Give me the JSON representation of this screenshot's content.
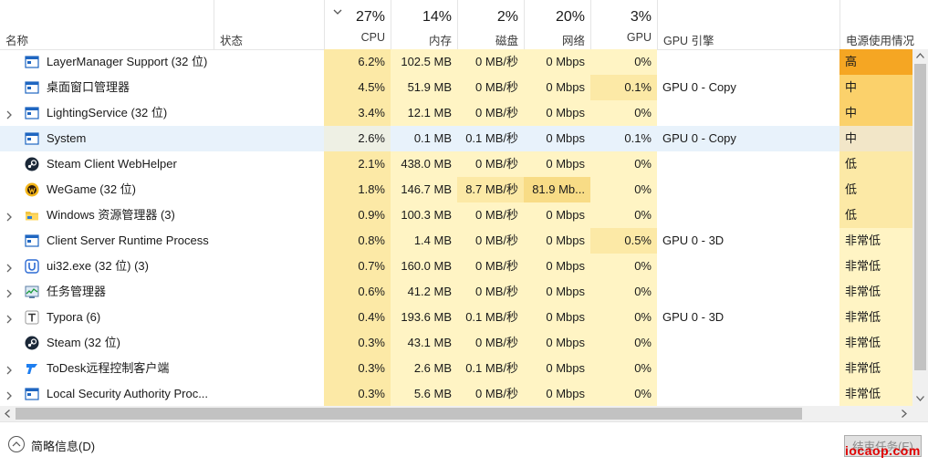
{
  "header": {
    "name_label": "名称",
    "status_label": "状态",
    "cpu": {
      "pct": "27%",
      "label": "CPU"
    },
    "memory": {
      "pct": "14%",
      "label": "内存"
    },
    "disk": {
      "pct": "2%",
      "label": "磁盘"
    },
    "network": {
      "pct": "20%",
      "label": "网络"
    },
    "gpu": {
      "pct": "3%",
      "label": "GPU"
    },
    "gpu_engine_label": "GPU 引擎",
    "power_label": "电源使用情况"
  },
  "colors": {
    "heat_light": "#fff4c4",
    "heat_mid": "#fce9a6",
    "heat_strong": "#f8dc86",
    "power_very_high": "#f5a623",
    "power_high": "#fbd16b",
    "power_low": "#fce9a6",
    "power_very_low": "#fff4c4",
    "selected_row": "#e8f2fb"
  },
  "rows": [
    {
      "name": "LayerManager Support (32 位)",
      "icon": "window-app-icon",
      "expandable": false,
      "cpu": "6.2%",
      "memory": "102.5 MB",
      "disk": "0 MB/秒",
      "network": "0 Mbps",
      "gpu": "0%",
      "gpu_engine": "",
      "power": "高",
      "power_level": "very_high",
      "selected": false,
      "gpu_hl": false,
      "disk_hl": false,
      "net_hl": false
    },
    {
      "name": "桌面窗口管理器",
      "icon": "window-app-icon",
      "expandable": false,
      "cpu": "4.5%",
      "memory": "51.9 MB",
      "disk": "0 MB/秒",
      "network": "0 Mbps",
      "gpu": "0.1%",
      "gpu_engine": "GPU 0 - Copy",
      "power": "中",
      "power_level": "high",
      "selected": false,
      "gpu_hl": true,
      "disk_hl": false,
      "net_hl": false
    },
    {
      "name": "LightingService (32 位)",
      "icon": "window-app-icon",
      "expandable": true,
      "cpu": "3.4%",
      "memory": "12.1 MB",
      "disk": "0 MB/秒",
      "network": "0 Mbps",
      "gpu": "0%",
      "gpu_engine": "",
      "power": "中",
      "power_level": "high",
      "selected": false,
      "gpu_hl": false,
      "disk_hl": false,
      "net_hl": false
    },
    {
      "name": "System",
      "icon": "window-app-icon",
      "expandable": false,
      "cpu": "2.6%",
      "memory": "0.1 MB",
      "disk": "0.1 MB/秒",
      "network": "0 Mbps",
      "gpu": "0.1%",
      "gpu_engine": "GPU 0 - Copy",
      "power": "中",
      "power_level": "high",
      "selected": true,
      "gpu_hl": true,
      "disk_hl": true,
      "net_hl": false
    },
    {
      "name": "Steam Client WebHelper",
      "icon": "steam-icon",
      "expandable": false,
      "cpu": "2.1%",
      "memory": "438.0 MB",
      "disk": "0 MB/秒",
      "network": "0 Mbps",
      "gpu": "0%",
      "gpu_engine": "",
      "power": "低",
      "power_level": "low",
      "selected": false,
      "gpu_hl": false,
      "disk_hl": false,
      "net_hl": false
    },
    {
      "name": "WeGame (32 位)",
      "icon": "wegame-icon",
      "expandable": false,
      "cpu": "1.8%",
      "memory": "146.7 MB",
      "disk": "8.7 MB/秒",
      "network": "81.9 Mb...",
      "gpu": "0%",
      "gpu_engine": "",
      "power": "低",
      "power_level": "low",
      "selected": false,
      "gpu_hl": false,
      "disk_hl": true,
      "net_hl": true
    },
    {
      "name": "Windows 资源管理器 (3)",
      "icon": "folder-icon",
      "expandable": true,
      "cpu": "0.9%",
      "memory": "100.3 MB",
      "disk": "0 MB/秒",
      "network": "0 Mbps",
      "gpu": "0%",
      "gpu_engine": "",
      "power": "低",
      "power_level": "low",
      "selected": false,
      "gpu_hl": false,
      "disk_hl": false,
      "net_hl": false
    },
    {
      "name": "Client Server Runtime Process",
      "icon": "window-app-icon",
      "expandable": false,
      "cpu": "0.8%",
      "memory": "1.4 MB",
      "disk": "0 MB/秒",
      "network": "0 Mbps",
      "gpu": "0.5%",
      "gpu_engine": "GPU 0 - 3D",
      "power": "非常低",
      "power_level": "very_low",
      "selected": false,
      "gpu_hl": true,
      "disk_hl": false,
      "net_hl": false
    },
    {
      "name": "ui32.exe (32 位) (3)",
      "icon": "ui32-icon",
      "expandable": true,
      "cpu": "0.7%",
      "memory": "160.0 MB",
      "disk": "0 MB/秒",
      "network": "0 Mbps",
      "gpu": "0%",
      "gpu_engine": "",
      "power": "非常低",
      "power_level": "very_low",
      "selected": false,
      "gpu_hl": false,
      "disk_hl": false,
      "net_hl": false
    },
    {
      "name": "任务管理器",
      "icon": "task-manager-icon",
      "expandable": true,
      "cpu": "0.6%",
      "memory": "41.2 MB",
      "disk": "0 MB/秒",
      "network": "0 Mbps",
      "gpu": "0%",
      "gpu_engine": "",
      "power": "非常低",
      "power_level": "very_low",
      "selected": false,
      "gpu_hl": false,
      "disk_hl": false,
      "net_hl": false
    },
    {
      "name": "Typora (6)",
      "icon": "typora-icon",
      "expandable": true,
      "cpu": "0.4%",
      "memory": "193.6 MB",
      "disk": "0.1 MB/秒",
      "network": "0 Mbps",
      "gpu": "0%",
      "gpu_engine": "GPU 0 - 3D",
      "power": "非常低",
      "power_level": "very_low",
      "selected": false,
      "gpu_hl": false,
      "disk_hl": false,
      "net_hl": false
    },
    {
      "name": "Steam (32 位)",
      "icon": "steam-icon",
      "expandable": false,
      "cpu": "0.3%",
      "memory": "43.1 MB",
      "disk": "0 MB/秒",
      "network": "0 Mbps",
      "gpu": "0%",
      "gpu_engine": "",
      "power": "非常低",
      "power_level": "very_low",
      "selected": false,
      "gpu_hl": false,
      "disk_hl": false,
      "net_hl": false
    },
    {
      "name": "ToDesk远程控制客户端",
      "icon": "todesk-icon",
      "expandable": true,
      "cpu": "0.3%",
      "memory": "2.6 MB",
      "disk": "0.1 MB/秒",
      "network": "0 Mbps",
      "gpu": "0%",
      "gpu_engine": "",
      "power": "非常低",
      "power_level": "very_low",
      "selected": false,
      "gpu_hl": false,
      "disk_hl": false,
      "net_hl": false
    },
    {
      "name": "Local Security Authority Proc...",
      "icon": "window-app-icon",
      "expandable": true,
      "cpu": "0.3%",
      "memory": "5.6 MB",
      "disk": "0 MB/秒",
      "network": "0 Mbps",
      "gpu": "0%",
      "gpu_engine": "",
      "power": "非常低",
      "power_level": "very_low",
      "selected": false,
      "gpu_hl": false,
      "disk_hl": false,
      "net_hl": false
    }
  ],
  "footer": {
    "fewer_details_label": "简略信息(D)",
    "end_task_label": "结束任务(E)",
    "watermark": "iocaop.com"
  }
}
